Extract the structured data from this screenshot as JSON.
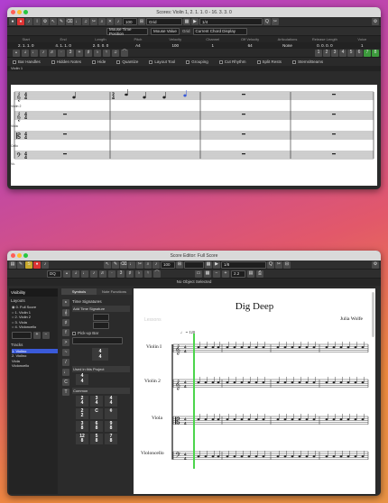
{
  "top": {
    "title": "Scores: Violin 1, 2. 1. 1. 0 - 16. 3. 3. 0",
    "tempo": "100",
    "snap": "Grid",
    "quantize": "1/4",
    "row2": {
      "mouse_pos": "Mouse Time Position",
      "mouse_val": "Mouse Value",
      "grid": "Grid",
      "chord": "Current Chord Display"
    },
    "info_headers": [
      "Start",
      "End",
      "Length",
      "Pitch",
      "Velocity",
      "Channel",
      "Off Velocity",
      "Articulations",
      "Release Length",
      "Voice"
    ],
    "info_values": [
      "2. 1. 1. 0",
      "4. 1. 1. 0",
      "2. 0. 0. 0",
      "A4",
      "100",
      "1",
      "64",
      "None",
      "0. 0. 0. 0",
      "1"
    ],
    "voice_nums": [
      "1",
      "2",
      "3",
      "4",
      "5",
      "6",
      "7",
      "8"
    ],
    "options": [
      "Bar Handles",
      "Hidden Notes",
      "Hide",
      "Quantize",
      "Layout Tool",
      "Grouping",
      "Cut Rhythm",
      "Split Rests",
      "Stems/Beams"
    ],
    "staff_labels": [
      "Violin 1",
      "Violin 2",
      "Viola",
      "Cello",
      "Vc."
    ],
    "track_label": "Violin 1"
  },
  "bottom": {
    "title": "Score Editor: Full Score",
    "tempo": "100",
    "quantize": "1/8",
    "zoom": "2.2",
    "status": "No Object Selected",
    "tabs": [
      "Visibility"
    ],
    "layouts_label": "Layouts",
    "layouts": [
      "0. Full Score",
      "1. Violin 1",
      "2. Violin 2",
      "3. Viola",
      "4. Violoncello"
    ],
    "tracks_label": "Tracks",
    "tracks": [
      "1. Violino",
      "2. Violino",
      "Viola",
      "Violoncello"
    ],
    "symbol_tabs": [
      "Symbols",
      "Note Functions"
    ],
    "ts_label": "Time Signatures",
    "ts_add": "Add Time Signature",
    "pickup": "Pick-up Bar",
    "used_label": "Used in this Project",
    "common_label": "Common",
    "used_ts": [
      [
        "4",
        "4"
      ]
    ],
    "common_ts": [
      [
        "2",
        "4"
      ],
      [
        "3",
        "4"
      ],
      [
        "4",
        "4"
      ],
      [
        "2",
        "2"
      ],
      [
        "C",
        ""
      ],
      [
        "¢",
        ""
      ],
      [
        "3",
        "8"
      ],
      [
        "6",
        "8"
      ],
      [
        "9",
        "8"
      ],
      [
        "12",
        "8"
      ],
      [
        "5",
        "8"
      ],
      [
        "7",
        "8"
      ]
    ],
    "score_title": "Dig Deep",
    "composer": "Julia Wolfe",
    "tempo_mark": "♩ = 120",
    "instruments": [
      "Violin I",
      "Violin 2",
      "Viola",
      "Violoncello"
    ],
    "faint_text": "Lessons"
  }
}
